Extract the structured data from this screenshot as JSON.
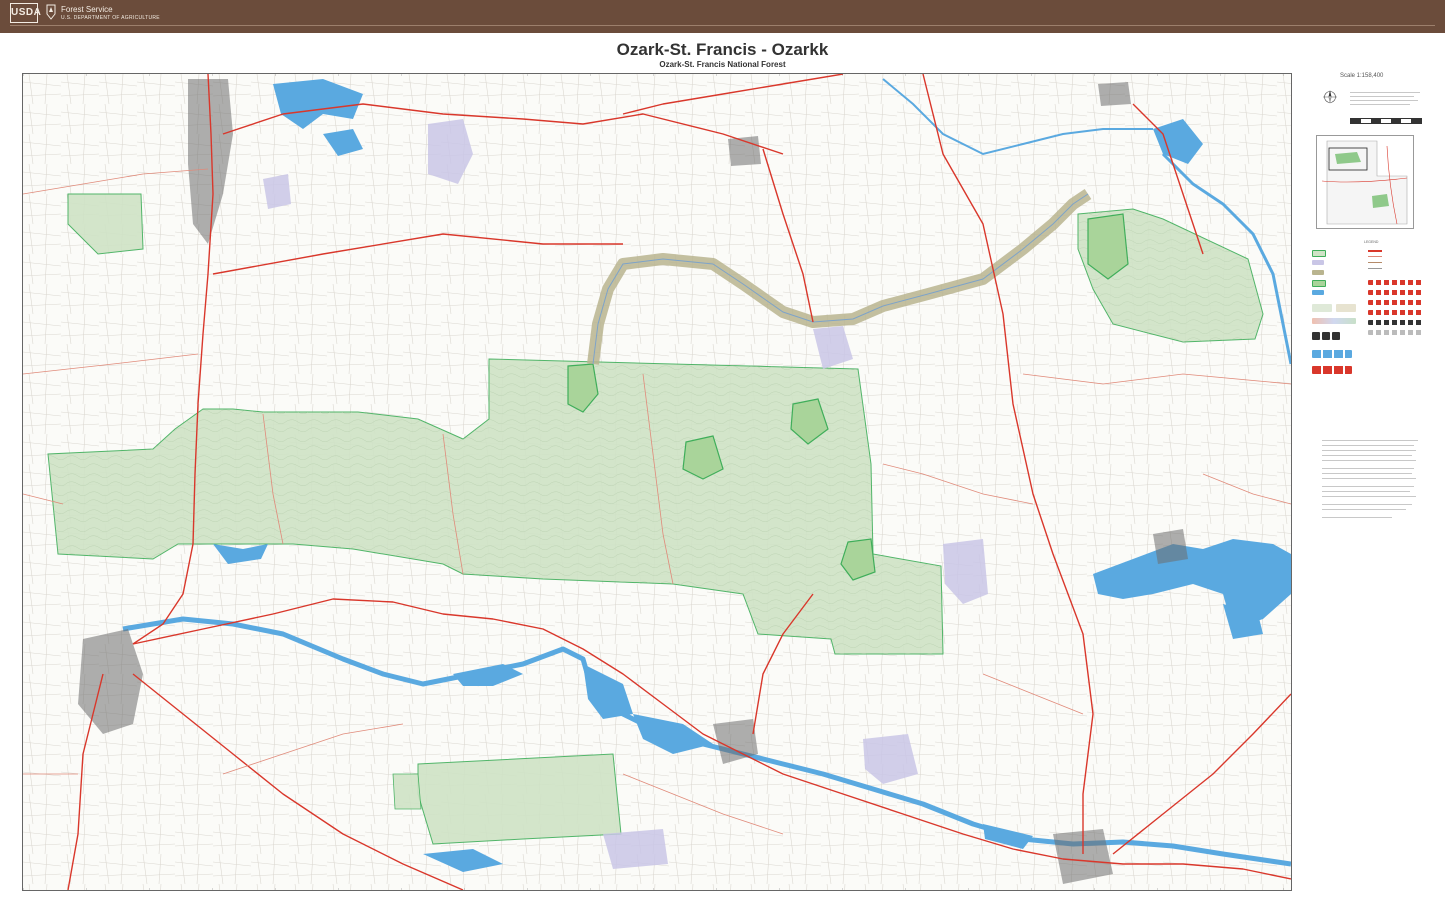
{
  "header": {
    "logo_text": "USDA",
    "agency_line1": "Forest Service",
    "agency_line2": "U.S. DEPARTMENT OF AGRICULTURE"
  },
  "map": {
    "title": "Ozark-St. Francis - Ozarkk",
    "subtitle": "Ozark-St. Francis National Forest",
    "scale_text": "Scale 1:158,400",
    "legend_title": "LEGEND"
  },
  "colors": {
    "header_bg": "#6b4c3b",
    "forest_green": "#cfe3c6",
    "forest_border": "#3fae5a",
    "water": "#5aa9e0",
    "road_major": "#d9372b",
    "road_minor": "#e08a7a",
    "wilderness": "#b9b48f",
    "private_land": "#c9c6e6",
    "urban": "#6d6d6d"
  },
  "icons": [
    "usda-logo",
    "forest-service-shield-icon",
    "north-arrow-icon",
    "locator-map"
  ]
}
